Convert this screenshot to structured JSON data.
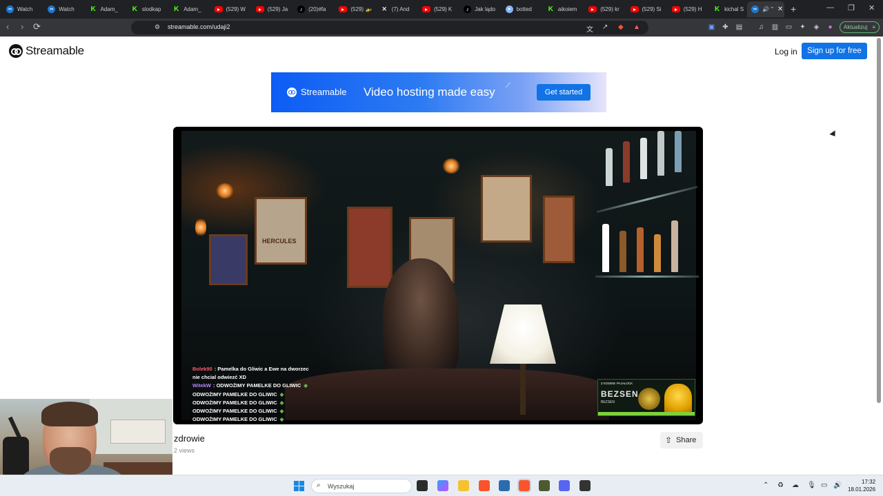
{
  "browser": {
    "tabs": [
      {
        "label": "Watch",
        "icon": "streamable-icon"
      },
      {
        "label": "Watch",
        "icon": "streamable-icon"
      },
      {
        "label": "Adam_",
        "icon": "kick-icon"
      },
      {
        "label": "slodkap",
        "icon": "kick-icon"
      },
      {
        "label": "Adam_",
        "icon": "kick-icon"
      },
      {
        "label": "(529) W",
        "icon": "youtube-icon"
      },
      {
        "label": "(529) Ja",
        "icon": "youtube-icon"
      },
      {
        "label": "(20)#fa",
        "icon": "tiktok-icon"
      },
      {
        "label": "(529) 🚁",
        "icon": "youtube-icon"
      },
      {
        "label": "(7) And",
        "icon": "x-icon"
      },
      {
        "label": "(529) K",
        "icon": "youtube-icon"
      },
      {
        "label": "Jak lądo",
        "icon": "tiktok-icon"
      },
      {
        "label": "botted",
        "icon": "bot-icon"
      },
      {
        "label": "aikoiem",
        "icon": "kick-icon"
      },
      {
        "label": "(529) kr",
        "icon": "youtube-icon"
      },
      {
        "label": "(529) Si",
        "icon": "youtube-icon"
      },
      {
        "label": "(529) H",
        "icon": "youtube-icon"
      },
      {
        "label": "kichal S",
        "icon": "kick-icon"
      }
    ],
    "active_tab_label": "\"",
    "url": "streamable.com/udaji2",
    "update_button": "Aktualizuj"
  },
  "header": {
    "logo_text": "Streamable",
    "login": "Log in",
    "signup": "Sign up for free"
  },
  "banner": {
    "brand": "Streamable",
    "tagline": "Video hosting made easy",
    "cta": "Get started"
  },
  "video": {
    "title": "zdrowie",
    "views": "2 views",
    "share": "Share",
    "scene_text": {
      "poster": "HERCULES",
      "chat": [
        {
          "user": "Bolek90",
          "text": ": Pamelka do Gliwic a Ewe na dworzec"
        },
        {
          "user": "",
          "text": "nie chcial odwiezć XD"
        },
        {
          "user": "WitekW",
          "text": ": ODWOŻIMY PAMELKE DO GLIWIC"
        },
        {
          "user": "",
          "text": "ODWOŻIMY PAMELKE DO GLIWIC"
        },
        {
          "user": "",
          "text": "ODWOŻIMY PAMELKE DO GLIWIC"
        },
        {
          "user": "",
          "text": "ODWOŻIMY PAMELKE DO GLIWIC"
        },
        {
          "user": "",
          "text": "ODWOŻIMY PAMELKE DO GLIWIC"
        }
      ],
      "sponsor_top": "Z KODEM: PAJALOCK",
      "sponsor_brand": "BEZSEN",
      "sponsor_sub": "BEZSEN"
    }
  },
  "taskbar": {
    "search_placeholder": "Wyszukaj",
    "time": "17:32",
    "date": "18.01.2026"
  }
}
